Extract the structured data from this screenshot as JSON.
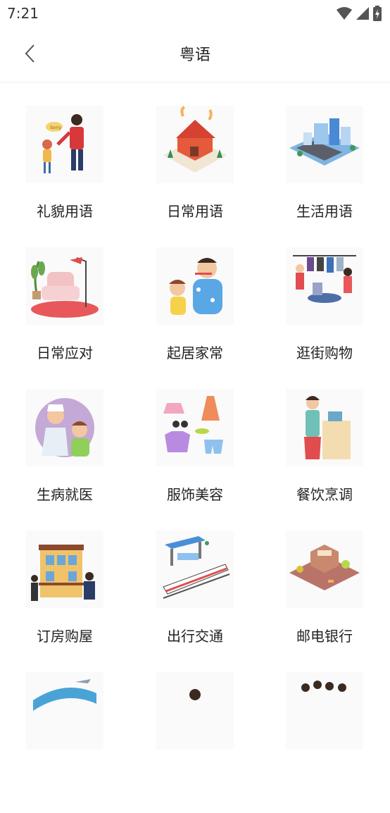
{
  "status": {
    "time": "7:21"
  },
  "header": {
    "title": "粤语",
    "back_icon": "chevron-left-icon"
  },
  "categories": [
    {
      "label": "礼貌用语",
      "icon": "greeting-illustration"
    },
    {
      "label": "日常用语",
      "icon": "house-illustration"
    },
    {
      "label": "生活用语",
      "icon": "city-illustration"
    },
    {
      "label": "日常应对",
      "icon": "living-room-illustration"
    },
    {
      "label": "起居家常",
      "icon": "toothbrush-illustration"
    },
    {
      "label": "逛街购物",
      "icon": "clothes-shop-illustration"
    },
    {
      "label": "生病就医",
      "icon": "doctor-illustration"
    },
    {
      "label": "服饰美容",
      "icon": "fashion-illustration"
    },
    {
      "label": "餐饮烹调",
      "icon": "cooking-illustration"
    },
    {
      "label": "订房购屋",
      "icon": "building-illustration"
    },
    {
      "label": "出行交通",
      "icon": "train-illustration"
    },
    {
      "label": "邮电银行",
      "icon": "bank-illustration"
    }
  ]
}
